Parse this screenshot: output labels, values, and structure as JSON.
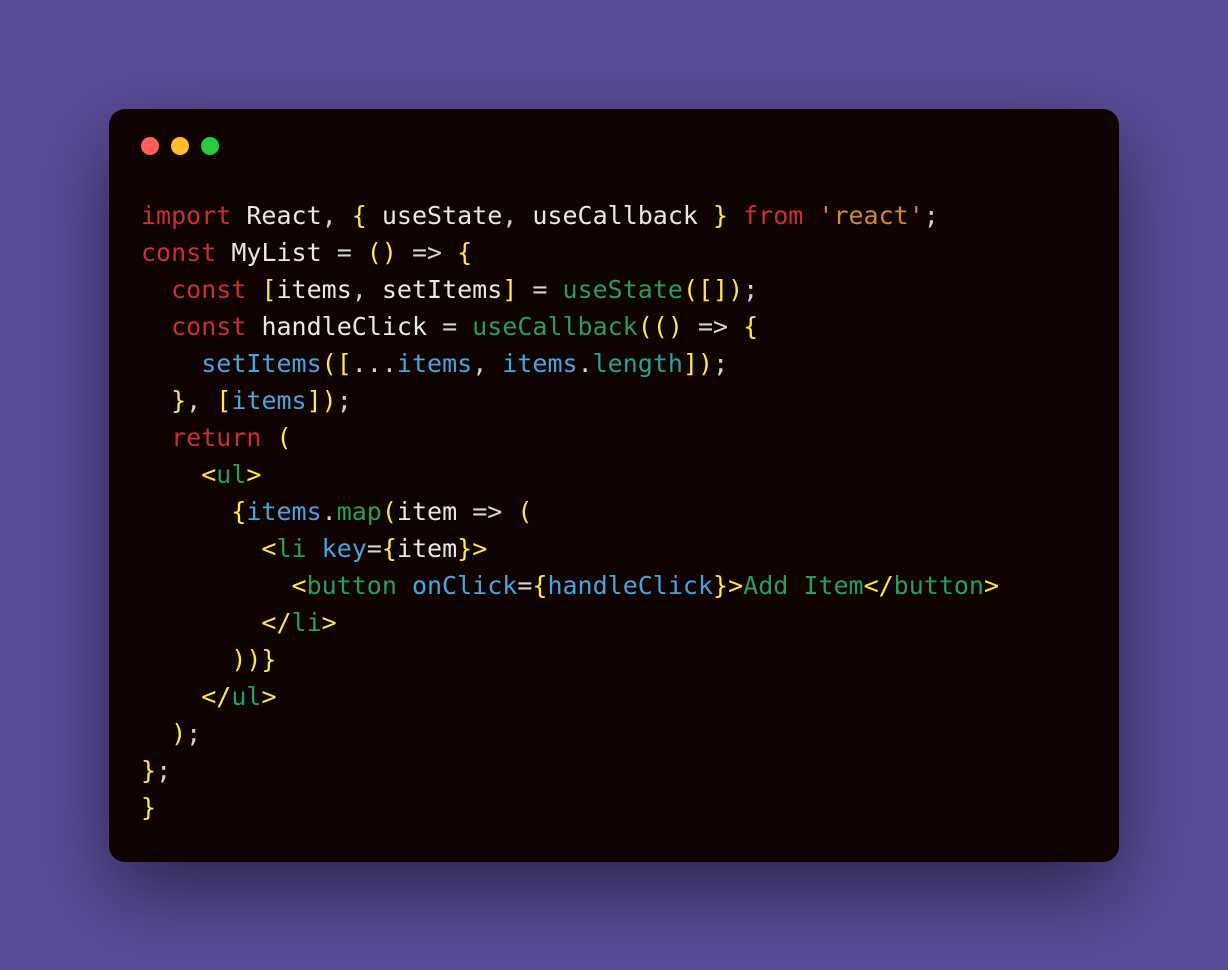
{
  "code": {
    "tokens": [
      [
        {
          "c": "kw-import",
          "t": "import"
        },
        {
          "c": "ident",
          "t": " React"
        },
        {
          "c": "punct",
          "t": ", "
        },
        {
          "c": "brace",
          "t": "{"
        },
        {
          "c": "ident",
          "t": " useState"
        },
        {
          "c": "punct",
          "t": ", "
        },
        {
          "c": "ident",
          "t": "useCallback "
        },
        {
          "c": "brace",
          "t": "}"
        },
        {
          "c": "punct",
          "t": " "
        },
        {
          "c": "kw-from",
          "t": "from"
        },
        {
          "c": "punct",
          "t": " "
        },
        {
          "c": "string",
          "t": "'react'"
        },
        {
          "c": "punct",
          "t": ";"
        }
      ],
      [
        {
          "c": "kw-const",
          "t": "const"
        },
        {
          "c": "punct",
          "t": " "
        },
        {
          "c": "fn-decl",
          "t": "MyList"
        },
        {
          "c": "punct",
          "t": " = "
        },
        {
          "c": "paren",
          "t": "()"
        },
        {
          "c": "punct",
          "t": " "
        },
        {
          "c": "arrow",
          "t": "=>"
        },
        {
          "c": "punct",
          "t": " "
        },
        {
          "c": "brace",
          "t": "{"
        }
      ],
      [
        {
          "c": "punct",
          "t": "  "
        },
        {
          "c": "kw-const",
          "t": "const"
        },
        {
          "c": "punct",
          "t": " "
        },
        {
          "c": "bracket",
          "t": "["
        },
        {
          "c": "ident",
          "t": "items"
        },
        {
          "c": "punct",
          "t": ", "
        },
        {
          "c": "ident",
          "t": "setItems"
        },
        {
          "c": "bracket",
          "t": "]"
        },
        {
          "c": "punct",
          "t": " = "
        },
        {
          "c": "fn-call",
          "t": "useState"
        },
        {
          "c": "paren",
          "t": "("
        },
        {
          "c": "bracket",
          "t": "[]"
        },
        {
          "c": "paren",
          "t": ")"
        },
        {
          "c": "punct",
          "t": ";"
        }
      ],
      [
        {
          "c": "punct",
          "t": "  "
        },
        {
          "c": "kw-const",
          "t": "const"
        },
        {
          "c": "punct",
          "t": " "
        },
        {
          "c": "fn-decl",
          "t": "handleClick"
        },
        {
          "c": "punct",
          "t": " = "
        },
        {
          "c": "fn-call",
          "t": "useCallback"
        },
        {
          "c": "paren",
          "t": "(()"
        },
        {
          "c": "punct",
          "t": " "
        },
        {
          "c": "arrow",
          "t": "=>"
        },
        {
          "c": "punct",
          "t": " "
        },
        {
          "c": "brace",
          "t": "{"
        }
      ],
      [
        {
          "c": "punct",
          "t": "    "
        },
        {
          "c": "var-blue",
          "t": "setItems"
        },
        {
          "c": "paren",
          "t": "("
        },
        {
          "c": "bracket",
          "t": "["
        },
        {
          "c": "punct",
          "t": "..."
        },
        {
          "c": "var-blue",
          "t": "items"
        },
        {
          "c": "punct",
          "t": ", "
        },
        {
          "c": "var-blue",
          "t": "items"
        },
        {
          "c": "punct",
          "t": "."
        },
        {
          "c": "prop-teal",
          "t": "length"
        },
        {
          "c": "bracket",
          "t": "]"
        },
        {
          "c": "paren",
          "t": ")"
        },
        {
          "c": "punct",
          "t": ";"
        }
      ],
      [
        {
          "c": "punct",
          "t": "  "
        },
        {
          "c": "brace",
          "t": "}"
        },
        {
          "c": "punct",
          "t": ", "
        },
        {
          "c": "bracket",
          "t": "["
        },
        {
          "c": "var-blue",
          "t": "items"
        },
        {
          "c": "bracket",
          "t": "]"
        },
        {
          "c": "paren",
          "t": ")"
        },
        {
          "c": "punct",
          "t": ";"
        }
      ],
      [
        {
          "c": "punct",
          "t": "  "
        },
        {
          "c": "kw-return",
          "t": "return"
        },
        {
          "c": "punct",
          "t": " "
        },
        {
          "c": "paren",
          "t": "("
        }
      ],
      [
        {
          "c": "punct",
          "t": "    "
        },
        {
          "c": "tag-open",
          "t": "<"
        },
        {
          "c": "tag-name",
          "t": "ul"
        },
        {
          "c": "tag-open",
          "t": ">"
        }
      ],
      [
        {
          "c": "punct",
          "t": "      "
        },
        {
          "c": "brace",
          "t": "{"
        },
        {
          "c": "var-blue",
          "t": "items"
        },
        {
          "c": "punct",
          "t": "."
        },
        {
          "c": "fn-call",
          "t": "map"
        },
        {
          "c": "paren",
          "t": "("
        },
        {
          "c": "ident",
          "t": "item"
        },
        {
          "c": "punct",
          "t": " "
        },
        {
          "c": "arrow",
          "t": "=>"
        },
        {
          "c": "punct",
          "t": " "
        },
        {
          "c": "paren",
          "t": "("
        }
      ],
      [
        {
          "c": "punct",
          "t": "        "
        },
        {
          "c": "tag-open",
          "t": "<"
        },
        {
          "c": "tag-name",
          "t": "li"
        },
        {
          "c": "punct",
          "t": " "
        },
        {
          "c": "attr",
          "t": "key"
        },
        {
          "c": "punct",
          "t": "="
        },
        {
          "c": "brace",
          "t": "{"
        },
        {
          "c": "ident",
          "t": "item"
        },
        {
          "c": "brace",
          "t": "}"
        },
        {
          "c": "tag-open",
          "t": ">"
        }
      ],
      [
        {
          "c": "punct",
          "t": "          "
        },
        {
          "c": "tag-open",
          "t": "<"
        },
        {
          "c": "tag-name",
          "t": "button"
        },
        {
          "c": "punct",
          "t": " "
        },
        {
          "c": "attr",
          "t": "onClick"
        },
        {
          "c": "punct",
          "t": "="
        },
        {
          "c": "brace",
          "t": "{"
        },
        {
          "c": "var-blue",
          "t": "handleClick"
        },
        {
          "c": "brace",
          "t": "}"
        },
        {
          "c": "tag-open",
          "t": ">"
        },
        {
          "c": "jsx-text",
          "t": "Add Item"
        },
        {
          "c": "tag-open",
          "t": "</"
        },
        {
          "c": "tag-name",
          "t": "button"
        },
        {
          "c": "tag-open",
          "t": ">"
        }
      ],
      [
        {
          "c": "punct",
          "t": "        "
        },
        {
          "c": "tag-open",
          "t": "</"
        },
        {
          "c": "tag-name",
          "t": "li"
        },
        {
          "c": "tag-open",
          "t": ">"
        }
      ],
      [
        {
          "c": "punct",
          "t": "      "
        },
        {
          "c": "paren",
          "t": "))"
        },
        {
          "c": "brace",
          "t": "}"
        }
      ],
      [
        {
          "c": "punct",
          "t": "    "
        },
        {
          "c": "tag-open",
          "t": "</"
        },
        {
          "c": "tag-name",
          "t": "ul"
        },
        {
          "c": "tag-open",
          "t": ">"
        }
      ],
      [
        {
          "c": "punct",
          "t": "  "
        },
        {
          "c": "paren",
          "t": ")"
        },
        {
          "c": "punct",
          "t": ";"
        }
      ],
      [
        {
          "c": "brace",
          "t": "}"
        },
        {
          "c": "punct",
          "t": ";"
        }
      ],
      [
        {
          "c": "brace",
          "t": "}"
        }
      ]
    ]
  }
}
